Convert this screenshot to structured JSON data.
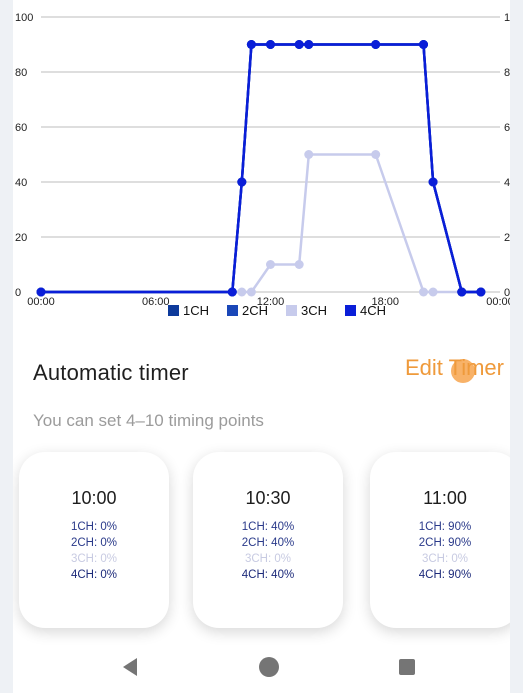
{
  "chart_data": {
    "type": "line",
    "x_unit": "hours",
    "x_ticks": [
      "00:00",
      "06:00",
      "12:00",
      "18:00",
      "00:00"
    ],
    "x_tick_hours": [
      0,
      6,
      12,
      18,
      24
    ],
    "y_ticks": [
      "0",
      "20",
      "40",
      "60",
      "80",
      "100"
    ],
    "ylim": [
      0,
      100
    ],
    "xlim": [
      0,
      24
    ],
    "grid": true,
    "legend_position": "bottom",
    "series": [
      {
        "name": "1CH",
        "color": "#0d3a9b",
        "points": [
          [
            0,
            0
          ],
          [
            10,
            0
          ],
          [
            10.5,
            40
          ],
          [
            11,
            90
          ],
          [
            12,
            90
          ],
          [
            13.5,
            90
          ],
          [
            14,
            90
          ],
          [
            17.5,
            90
          ],
          [
            20,
            90
          ],
          [
            20.5,
            40
          ],
          [
            22,
            0
          ],
          [
            23,
            0
          ]
        ]
      },
      {
        "name": "2CH",
        "color": "#1a47b8",
        "points": [
          [
            0,
            0
          ],
          [
            10,
            0
          ],
          [
            10.5,
            40
          ],
          [
            11,
            90
          ],
          [
            12,
            90
          ],
          [
            13.5,
            90
          ],
          [
            14,
            90
          ],
          [
            17.5,
            90
          ],
          [
            20,
            90
          ],
          [
            20.5,
            40
          ],
          [
            22,
            0
          ],
          [
            23,
            0
          ]
        ]
      },
      {
        "name": "3CH",
        "color": "#c7cbec",
        "points": [
          [
            0,
            0
          ],
          [
            10,
            0
          ],
          [
            10.5,
            0
          ],
          [
            11,
            0
          ],
          [
            12,
            10
          ],
          [
            13.5,
            10
          ],
          [
            14,
            50
          ],
          [
            17.5,
            50
          ],
          [
            20,
            0
          ],
          [
            20.5,
            0
          ],
          [
            22,
            0
          ],
          [
            23,
            0
          ]
        ]
      },
      {
        "name": "4CH",
        "color": "#0a1ed8",
        "points": [
          [
            0,
            0
          ],
          [
            10,
            0
          ],
          [
            10.5,
            40
          ],
          [
            11,
            90
          ],
          [
            12,
            90
          ],
          [
            13.5,
            90
          ],
          [
            14,
            90
          ],
          [
            17.5,
            90
          ],
          [
            20,
            90
          ],
          [
            20.5,
            40
          ],
          [
            22,
            0
          ],
          [
            23,
            0
          ]
        ]
      }
    ]
  },
  "section": {
    "title": "Automatic timer",
    "edit_label": "Edit Timer",
    "subtitle": "You can set 4–10 timing points"
  },
  "cards": [
    {
      "time": "10:00",
      "ch1": "1CH: 0%",
      "ch2": "2CH: 0%",
      "ch3": "3CH: 0%",
      "ch4": "4CH: 0%"
    },
    {
      "time": "10:30",
      "ch1": "1CH: 40%",
      "ch2": "2CH: 40%",
      "ch3": "3CH: 0%",
      "ch4": "4CH: 40%"
    },
    {
      "time": "11:00",
      "ch1": "1CH: 90%",
      "ch2": "2CH: 90%",
      "ch3": "3CH: 0%",
      "ch4": "4CH: 90%"
    }
  ],
  "navbar": {
    "back_icon": "back-triangle-icon",
    "home_icon": "home-circle-icon",
    "recent_icon": "recents-square-icon"
  }
}
